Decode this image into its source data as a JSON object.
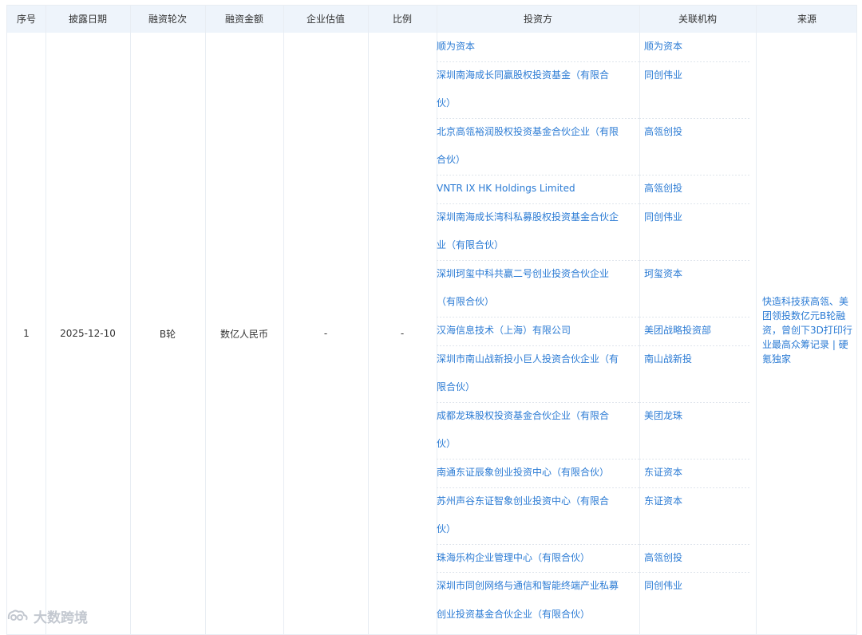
{
  "headers": [
    "序号",
    "披露日期",
    "融资轮次",
    "融资金额",
    "企业估值",
    "比例",
    "投资方",
    "关联机构",
    "来源"
  ],
  "row": {
    "index": "1",
    "date": "2025-12-10",
    "round": "B轮",
    "amount": "数亿人民币",
    "valuation": "-",
    "ratio": "-",
    "source": "快造科技获高瓴、美团领投数亿元B轮融资，曾创下3D打印行业最高众筹记录 | 硬氪独家"
  },
  "investors": [
    {
      "lines": [
        "顺为资本"
      ],
      "org": "顺为资本"
    },
    {
      "lines": [
        "深圳南海成长同赢股权投资基金（有限合",
        "伙）"
      ],
      "org": "同创伟业"
    },
    {
      "lines": [
        "北京高瓴裕润股权投资基金合伙企业（有限",
        "合伙）"
      ],
      "org": "高瓴创投"
    },
    {
      "lines": [
        "VNTR IX HK Holdings Limited"
      ],
      "org": "高瓴创投"
    },
    {
      "lines": [
        "深圳南海成长湾科私募股权投资基金合伙企",
        "业（有限合伙）"
      ],
      "org": "同创伟业"
    },
    {
      "lines": [
        "深圳珂玺中科共赢二号创业投资合伙企业",
        "（有限合伙）"
      ],
      "org": "珂玺资本"
    },
    {
      "lines": [
        "汉海信息技术（上海）有限公司"
      ],
      "org": "美团战略投资部"
    },
    {
      "lines": [
        "深圳市南山战新投小巨人投资合伙企业（有",
        "限合伙）"
      ],
      "org": "南山战新投"
    },
    {
      "lines": [
        "成都龙珠股权投资基金合伙企业（有限合",
        "伙）"
      ],
      "org": "美团龙珠"
    },
    {
      "lines": [
        "南通东证辰象创业投资中心（有限合伙）"
      ],
      "org": "东证资本"
    },
    {
      "lines": [
        "苏州声谷东证智象创业投资中心（有限合",
        "伙）"
      ],
      "org": "东证资本"
    },
    {
      "lines": [
        "珠海乐构企业管理中心（有限合伙）"
      ],
      "org": "高瓴创投"
    },
    {
      "lines": [
        "深圳市同创网络与通信和智能终端产业私募",
        "创业投资基金合伙企业（有限合伙）"
      ],
      "org": "同创伟业"
    }
  ],
  "watermark": "大数跨境",
  "colors": {
    "link": "#2b7bd4",
    "header_bg": "#eef4fb",
    "border": "#e8edf3"
  }
}
